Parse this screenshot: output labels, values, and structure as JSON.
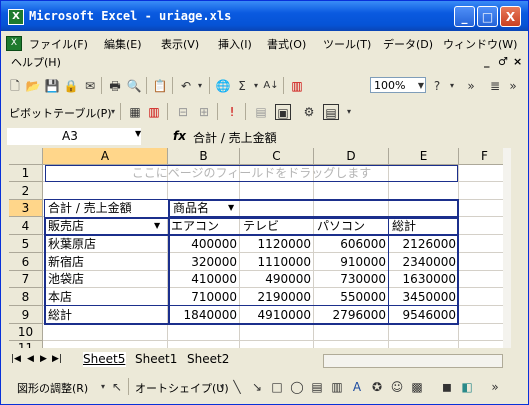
{
  "window": {
    "title": "Microsoft Excel - uriage.xls",
    "app_icon": "X",
    "minimize": "_",
    "maximize": "□",
    "close": "X"
  },
  "menubar": {
    "items": [
      "ファイル(F)",
      "編集(E)",
      "表示(V)",
      "挿入(I)",
      "書式(O)",
      "ツール(T)",
      "データ(D)",
      "ウィンドウ(W)"
    ],
    "help": "ヘルプ(H)",
    "mdi_min": "_",
    "mdi_restore": "♂",
    "mdi_close": "×"
  },
  "toolbar1": {
    "zoom": "100%",
    "autosum": "Σ",
    "help": "?"
  },
  "toolbar2": {
    "pivot_label": "ピボットテーブル(P)"
  },
  "formula_bar": {
    "name_box": "A3",
    "fx": "fx",
    "value": "合計 / 売上金額"
  },
  "grid": {
    "columns": [
      "A",
      "B",
      "C",
      "D",
      "E",
      "F"
    ],
    "rows": [
      "1",
      "2",
      "3",
      "4",
      "5",
      "6",
      "7",
      "8",
      "9",
      "10",
      "11"
    ],
    "page_field_hint": "ここにページのフィールドをドラッグします",
    "data_label": "合計 / 売上金額",
    "column_field": "商品名",
    "row_field": "販売店",
    "column_items": [
      "エアコン",
      "テレビ",
      "パソコン",
      "総計"
    ],
    "table": [
      {
        "label": "秋葉原店",
        "values": [
          "400000",
          "1120000",
          "606000",
          "2126000"
        ]
      },
      {
        "label": "新宿店",
        "values": [
          "320000",
          "1110000",
          "910000",
          "2340000"
        ]
      },
      {
        "label": "池袋店",
        "values": [
          "410000",
          "490000",
          "730000",
          "1630000"
        ]
      },
      {
        "label": "本店",
        "values": [
          "710000",
          "2190000",
          "550000",
          "3450000"
        ]
      },
      {
        "label": "総計",
        "values": [
          "1840000",
          "4910000",
          "2796000",
          "9546000"
        ]
      }
    ]
  },
  "sheets": {
    "tabs": [
      "Sheet5",
      "Sheet1",
      "Sheet2"
    ],
    "active": "Sheet5"
  },
  "draw_toolbar": {
    "adjust_label": "図形の調整(R)",
    "autoshape_label": "オートシェイプ(U)"
  },
  "colors": {
    "titlebar": "#0553d6",
    "pivot_border": "#1b2f8c",
    "selection_header": "#ffd68a"
  }
}
